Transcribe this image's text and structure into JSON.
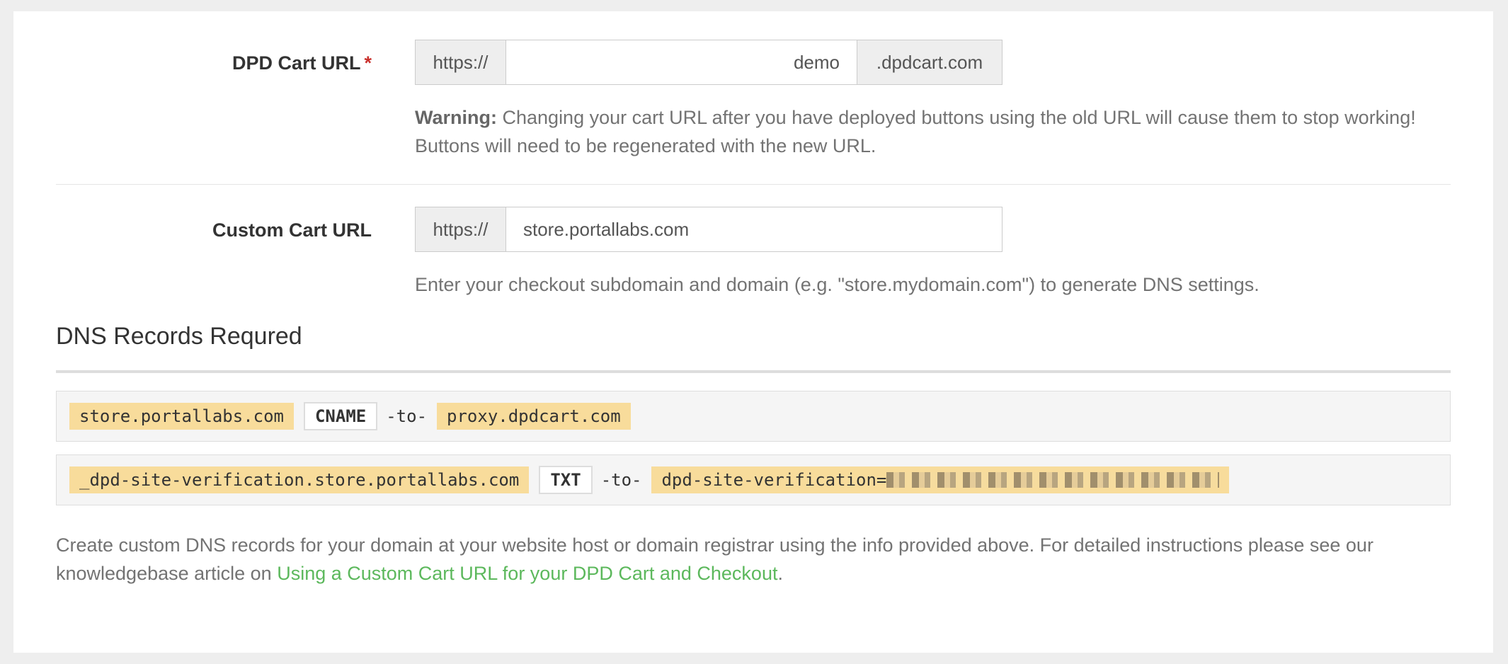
{
  "dpd_cart_url": {
    "label": "DPD Cart URL",
    "required_marker": "*",
    "prefix": "https://",
    "value": "demo",
    "suffix": ".dpdcart.com",
    "warning_label": "Warning:",
    "warning_text": "Changing your cart URL after you have deployed buttons using the old URL will cause them to stop working! Buttons will need to be regenerated with the new URL."
  },
  "custom_cart_url": {
    "label": "Custom Cart URL",
    "prefix": "https://",
    "value": "store.portallabs.com",
    "help_text": "Enter your checkout subdomain and domain (e.g. \"store.mydomain.com\") to generate DNS settings."
  },
  "dns_section": {
    "title": "DNS Records Requred",
    "records": [
      {
        "host": "store.portallabs.com",
        "type": "CNAME",
        "connector": "-to-",
        "target": "proxy.dpdcart.com"
      },
      {
        "host": "_dpd-site-verification.store.portallabs.com",
        "type": "TXT",
        "connector": "-to-",
        "target": "dpd-site-verification="
      }
    ],
    "footer_text": "Create custom DNS records for your domain at your website host or domain registrar using the info provided above. For detailed instructions please see our knowledgebase article on ",
    "footer_link": "Using a Custom Cart URL for your DPD Cart and Checkout",
    "footer_end": "."
  }
}
